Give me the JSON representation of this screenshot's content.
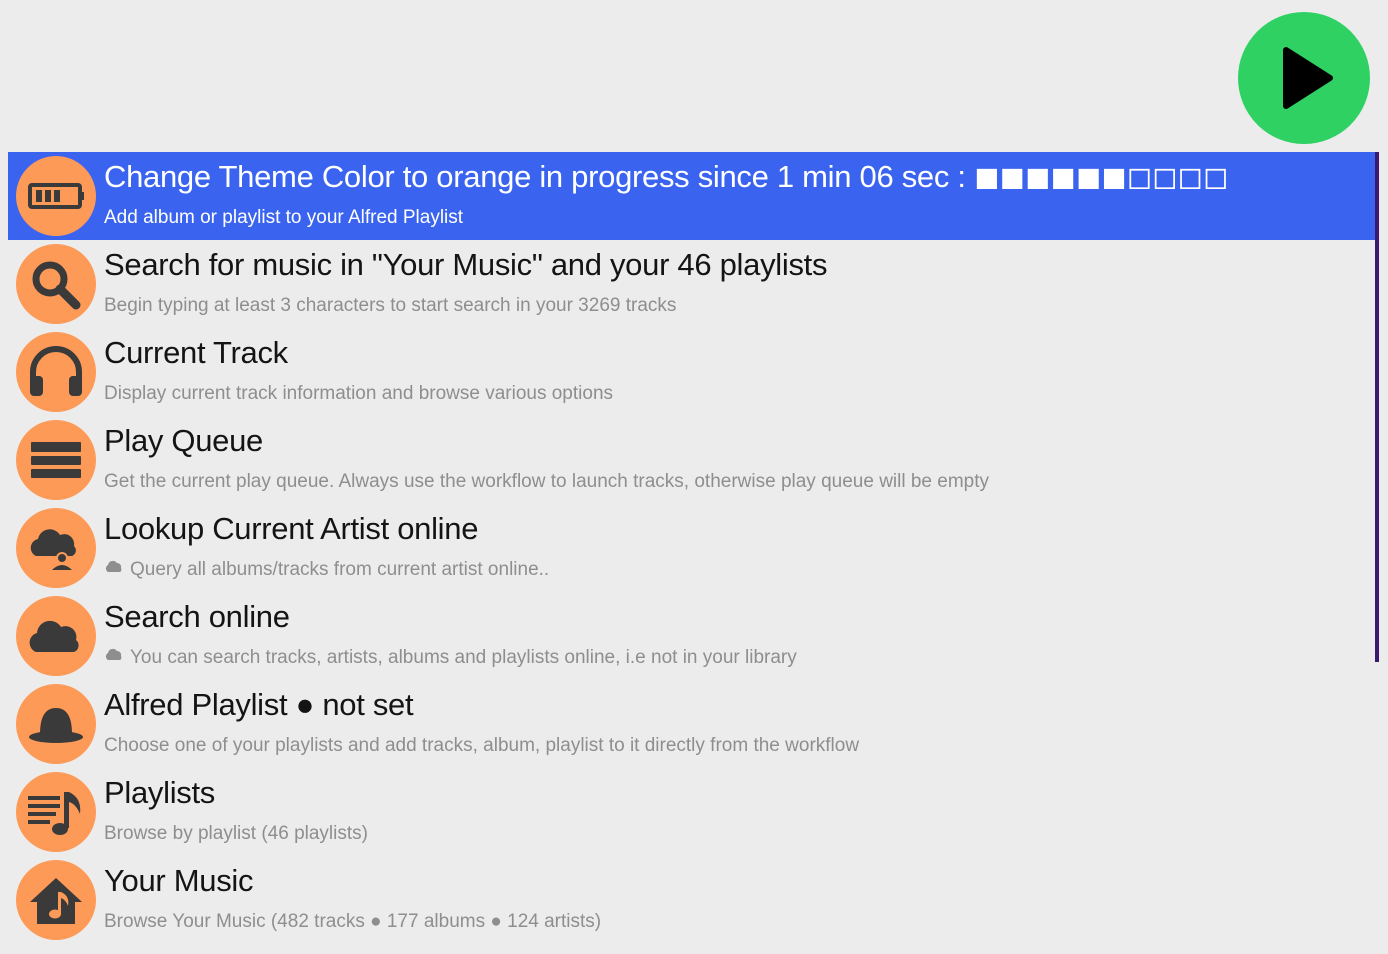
{
  "logo": {
    "icon": "play-icon",
    "color": "#2ed162"
  },
  "colors": {
    "background": "#ececec",
    "selected_row": "#3a64f0",
    "icon_circle": "#fe9a57",
    "scrollbar": "#3b1a6e"
  },
  "items": [
    {
      "title": "Change Theme Color to orange in progress since 1 min 06 sec : ◼◼◼◼◼◼◻◻◻◻",
      "subtitle": "Add album or playlist to your Alfred Playlist",
      "icon": "battery-progress-icon",
      "selected": true
    },
    {
      "title": "Search for music in \"Your Music\" and your 46 playlists",
      "subtitle": "Begin typing at least 3 characters to start search in your 3269 tracks",
      "icon": "search-icon"
    },
    {
      "title": "Current Track",
      "subtitle": "Display current track information and browse various options",
      "icon": "headphones-icon"
    },
    {
      "title": "Play Queue",
      "subtitle": "Get the current play queue. Always use the workflow to launch tracks, otherwise play queue will be empty",
      "icon": "queue-list-icon"
    },
    {
      "title": "Lookup Current Artist online",
      "subtitle": "Query all albums/tracks from current artist online..",
      "icon": "cloud-person-icon"
    },
    {
      "title": "Search online",
      "subtitle": "You can search tracks, artists, albums and playlists online, i.e not in your library",
      "icon": "cloud-icon"
    },
    {
      "title": "Alfred Playlist ● not set",
      "subtitle": "Choose one of your playlists and add tracks, album, playlist to it directly from the workflow",
      "icon": "bowler-hat-icon"
    },
    {
      "title": "Playlists",
      "subtitle": "Browse by playlist (46 playlists)",
      "icon": "playlist-note-icon"
    },
    {
      "title": "Your Music",
      "subtitle": "Browse Your Music (482 tracks ● 177  albums ● 124 artists)",
      "icon": "home-music-icon"
    }
  ]
}
